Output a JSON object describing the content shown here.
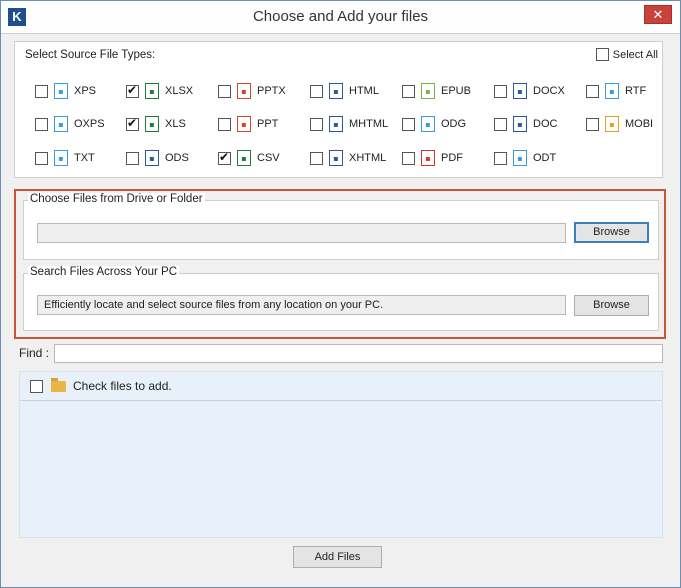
{
  "window": {
    "title": "Choose and Add your files",
    "logo": "K",
    "close_glyph": "✕"
  },
  "source_types": {
    "label": "Select Source File Types:",
    "select_all_label": "Select All",
    "select_all_checked": false,
    "rows": [
      [
        {
          "name": "XPS",
          "checked": false,
          "icon": "xps-icon",
          "color": "#3c9ad6"
        },
        {
          "name": "XLSX",
          "checked": true,
          "icon": "xlsx-icon",
          "color": "#1e7a3c"
        },
        {
          "name": "PPTX",
          "checked": false,
          "icon": "pptx-icon",
          "color": "#d24726"
        },
        {
          "name": "HTML",
          "checked": false,
          "icon": "html-icon",
          "color": "#2b5797"
        },
        {
          "name": "EPUB",
          "checked": false,
          "icon": "epub-icon",
          "color": "#7ab648"
        },
        {
          "name": "DOCX",
          "checked": false,
          "icon": "docx-icon",
          "color": "#2b579a"
        },
        {
          "name": "RTF",
          "checked": false,
          "icon": "rtf-icon",
          "color": "#3c9ad6"
        }
      ],
      [
        {
          "name": "OXPS",
          "checked": false,
          "icon": "oxps-icon",
          "color": "#3c9ad6"
        },
        {
          "name": "XLS",
          "checked": true,
          "icon": "xls-icon",
          "color": "#1e7a3c"
        },
        {
          "name": "PPT",
          "checked": false,
          "icon": "ppt-icon",
          "color": "#d24726"
        },
        {
          "name": "MHTML",
          "checked": false,
          "icon": "mhtml-icon",
          "color": "#2b5797"
        },
        {
          "name": "ODG",
          "checked": false,
          "icon": "odg-icon",
          "color": "#3c9ad6"
        },
        {
          "name": "DOC",
          "checked": false,
          "icon": "doc-icon",
          "color": "#2b579a"
        },
        {
          "name": "MOBI",
          "checked": false,
          "icon": "mobi-icon",
          "color": "#e0a020"
        }
      ],
      [
        {
          "name": "TXT",
          "checked": false,
          "icon": "txt-icon",
          "color": "#3c9ad6"
        },
        {
          "name": "ODS",
          "checked": false,
          "icon": "ods-icon",
          "color": "#2b5797"
        },
        {
          "name": "CSV",
          "checked": true,
          "icon": "csv-icon",
          "color": "#1e7a3c"
        },
        {
          "name": "XHTML",
          "checked": false,
          "icon": "xhtml-icon",
          "color": "#2b5797"
        },
        {
          "name": "PDF",
          "checked": false,
          "icon": "pdf-icon",
          "color": "#d9342b"
        },
        {
          "name": "ODT",
          "checked": false,
          "icon": "odt-icon",
          "color": "#3c9ad6"
        }
      ]
    ]
  },
  "drive": {
    "label": "Choose Files from Drive or Folder",
    "path_value": "",
    "browse_label": "Browse"
  },
  "search": {
    "label": "Search Files Across Your PC",
    "description": "Efficiently locate and select source files from any location on your PC.",
    "browse_label": "Browse"
  },
  "find": {
    "label": "Find :",
    "value": ""
  },
  "file_list": {
    "header_text": "Check files to add.",
    "header_checked": false
  },
  "add_button_label": "Add Files",
  "accent_color": "#c8553a"
}
